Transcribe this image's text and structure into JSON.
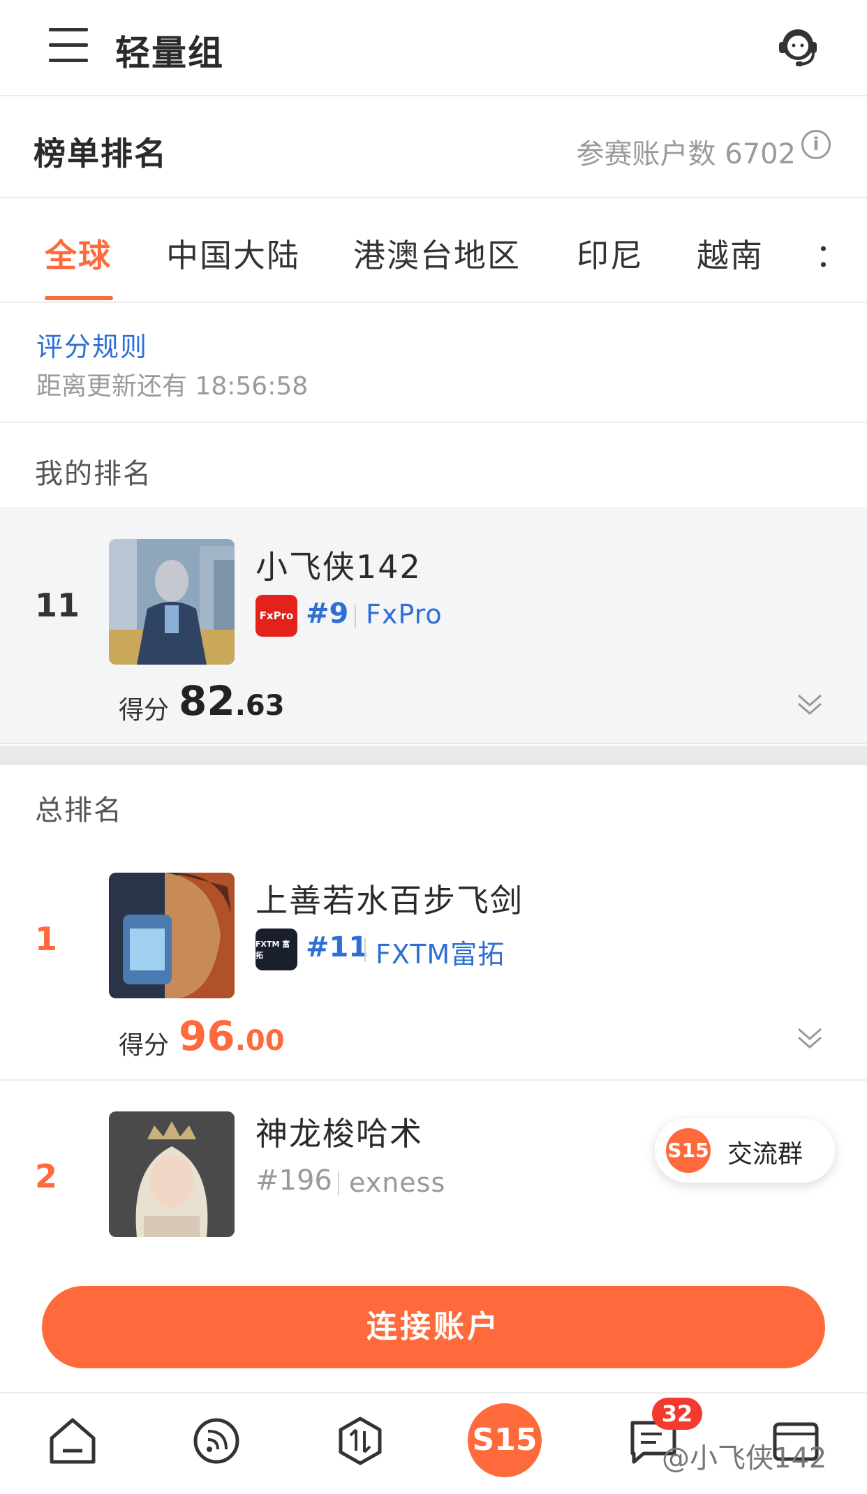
{
  "header": {
    "title": "轻量组",
    "menu_icon": "menu-icon",
    "support_icon": "headset-icon"
  },
  "leaderboard": {
    "title": "榜单排名",
    "count_text": "参赛账户数 6702",
    "info_icon": "i"
  },
  "tabs": [
    {
      "label": "全球",
      "active": true
    },
    {
      "label": "中国大陆",
      "active": false
    },
    {
      "label": "港澳台地区",
      "active": false
    },
    {
      "label": "印尼",
      "active": false
    },
    {
      "label": "越南",
      "active": false
    },
    {
      "label": "：",
      "active": false
    }
  ],
  "rules": {
    "link": "评分规则",
    "countdown": "距离更新还有 18:56:58"
  },
  "my_rank": {
    "section_label": "我的排名",
    "rank": "11",
    "name": "小飞侠142",
    "broker_logo_text": "FxPro",
    "broker_rank": "#9",
    "broker_name": "FxPro",
    "score_label": "得分",
    "score_int": "82",
    "score_dec": ".63"
  },
  "overall": {
    "section_label": "总排名",
    "entries": [
      {
        "rank": "1",
        "name": "上善若水百步飞剑",
        "broker_logo_text": "FXTM 富拓",
        "broker_rank": "#11",
        "broker_name": "FXTM富拓",
        "score_label": "得分",
        "score_int": "96",
        "score_dec": ".00"
      },
      {
        "rank": "2",
        "name": "神龙梭哈术",
        "broker_rank": "#196",
        "broker_name": "exness"
      }
    ]
  },
  "chat": {
    "logo": "S15",
    "label": "交流群"
  },
  "connect_button": "连接账户",
  "bottom_nav": {
    "center_logo": "S15",
    "message_badge": "32",
    "watermark": "@小飞侠142",
    "icons": [
      "home-icon",
      "feed-icon",
      "trade-icon",
      "s15-icon",
      "message-icon",
      "window-icon"
    ]
  },
  "colors": {
    "accent": "#ff6a3d",
    "link": "#2e6fd6",
    "badge_red": "#f23a2e"
  }
}
